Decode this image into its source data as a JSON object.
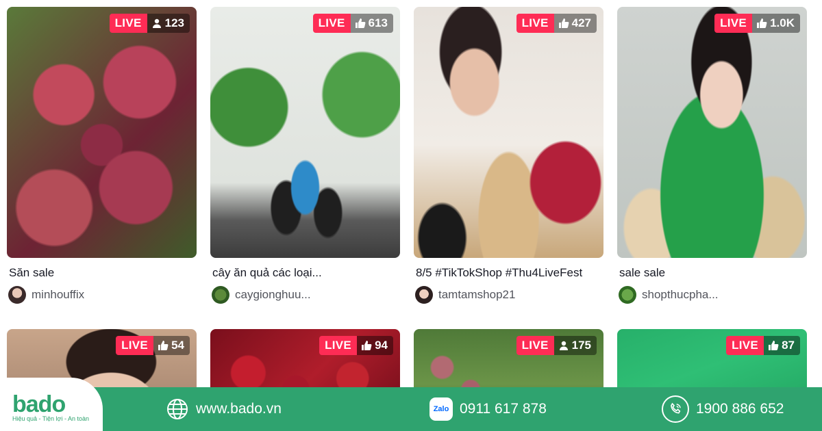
{
  "streams": [
    {
      "title": "Săn sale",
      "author": "minhouffix",
      "badge": {
        "live": "LIVE",
        "metric_icon": "viewer-icon",
        "count": "123"
      }
    },
    {
      "title": "cây ăn quả các loại...",
      "author": "caygionghuu...",
      "badge": {
        "live": "LIVE",
        "metric_icon": "like-icon",
        "count": "613"
      }
    },
    {
      "title": "8/5 #TikTokShop #Thu4LiveFest",
      "author": "tamtamshop21",
      "badge": {
        "live": "LIVE",
        "metric_icon": "like-icon",
        "count": "427"
      }
    },
    {
      "title": "sale sale",
      "author": "shopthucpha...",
      "badge": {
        "live": "LIVE",
        "metric_icon": "like-icon",
        "count": "1.0K"
      }
    },
    {
      "badge": {
        "live": "LIVE",
        "metric_icon": "like-icon",
        "count": "54"
      }
    },
    {
      "badge": {
        "live": "LIVE",
        "metric_icon": "like-icon",
        "count": "94"
      }
    },
    {
      "badge": {
        "live": "LIVE",
        "metric_icon": "viewer-icon",
        "count": "175"
      }
    },
    {
      "badge": {
        "live": "LIVE",
        "metric_icon": "like-icon",
        "count": "87"
      }
    }
  ],
  "banner": {
    "brand": "bado",
    "tagline": "Hiệu quả - Tiện lợi - An toàn",
    "website": "www.bado.vn",
    "zalo_label": "Zalo",
    "zalo_phone": "0911 617 878",
    "hotline": "1900 886 652"
  },
  "colors": {
    "live": "#fe2c55",
    "brand_green": "#2fa36f"
  }
}
